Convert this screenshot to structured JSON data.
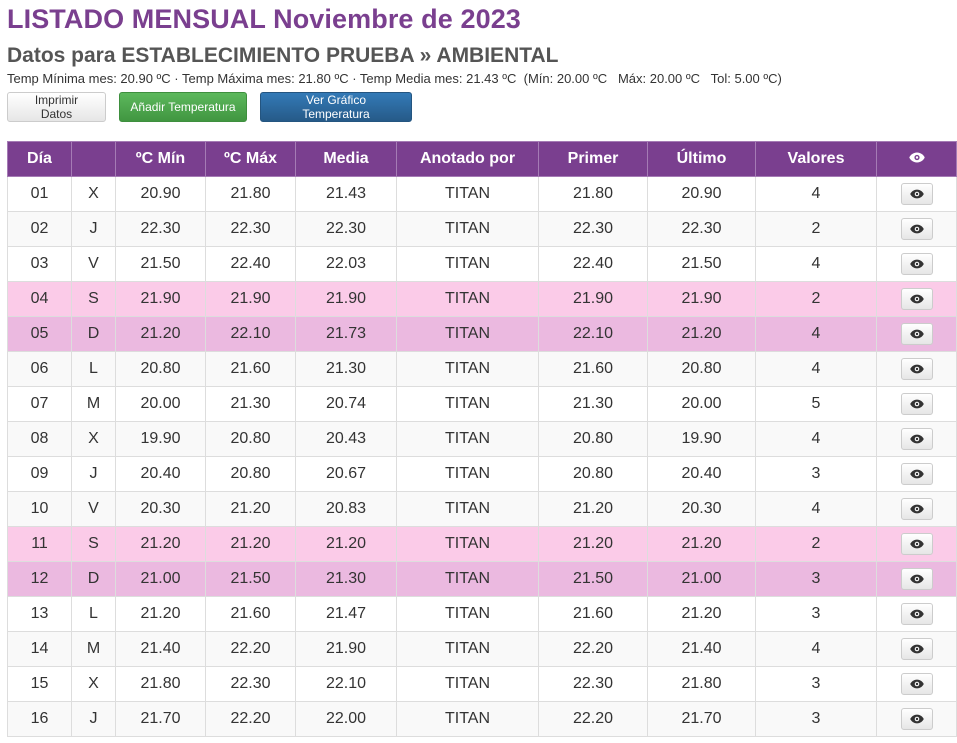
{
  "header": {
    "title": "LISTADO MENSUAL Noviembre de 2023",
    "subtitle": "Datos para ESTABLECIMIENTO PRUEBA » AMBIENTAL",
    "stats": "Temp Mínima mes: 20.90 ºC · Temp Máxima mes: 21.80 ºC · Temp Media mes: 21.43 ºC  (Mín: 20.00 ºC   Máx: 20.00 ºC   Tol: 5.00 ºC)"
  },
  "buttons": {
    "print": "Imprimir Datos",
    "add": "Añadir Temperatura",
    "chart": "Ver Gráfico Temperatura"
  },
  "table": {
    "columns": [
      "Día",
      "",
      "ºC Mín",
      "ºC Máx",
      "Media",
      "Anotado por",
      "Primer",
      "Último",
      "Valores"
    ],
    "action_icon": "eye-icon",
    "rows": [
      {
        "dia": "01",
        "dow": "X",
        "min": "20.90",
        "max": "21.80",
        "media": "21.43",
        "anotado": "TITAN",
        "primer": "21.80",
        "ultimo": "20.90",
        "valores": "4",
        "type": "odd"
      },
      {
        "dia": "02",
        "dow": "J",
        "min": "22.30",
        "max": "22.30",
        "media": "22.30",
        "anotado": "TITAN",
        "primer": "22.30",
        "ultimo": "22.30",
        "valores": "2",
        "type": "even"
      },
      {
        "dia": "03",
        "dow": "V",
        "min": "21.50",
        "max": "22.40",
        "media": "22.03",
        "anotado": "TITAN",
        "primer": "22.40",
        "ultimo": "21.50",
        "valores": "4",
        "type": "odd"
      },
      {
        "dia": "04",
        "dow": "S",
        "min": "21.90",
        "max": "21.90",
        "media": "21.90",
        "anotado": "TITAN",
        "primer": "21.90",
        "ultimo": "21.90",
        "valores": "2",
        "type": "sat"
      },
      {
        "dia": "05",
        "dow": "D",
        "min": "21.20",
        "max": "22.10",
        "media": "21.73",
        "anotado": "TITAN",
        "primer": "22.10",
        "ultimo": "21.20",
        "valores": "4",
        "type": "sun"
      },
      {
        "dia": "06",
        "dow": "L",
        "min": "20.80",
        "max": "21.60",
        "media": "21.30",
        "anotado": "TITAN",
        "primer": "21.60",
        "ultimo": "20.80",
        "valores": "4",
        "type": "even"
      },
      {
        "dia": "07",
        "dow": "M",
        "min": "20.00",
        "max": "21.30",
        "media": "20.74",
        "anotado": "TITAN",
        "primer": "21.30",
        "ultimo": "20.00",
        "valores": "5",
        "type": "odd"
      },
      {
        "dia": "08",
        "dow": "X",
        "min": "19.90",
        "max": "20.80",
        "media": "20.43",
        "anotado": "TITAN",
        "primer": "20.80",
        "ultimo": "19.90",
        "valores": "4",
        "type": "even"
      },
      {
        "dia": "09",
        "dow": "J",
        "min": "20.40",
        "max": "20.80",
        "media": "20.67",
        "anotado": "TITAN",
        "primer": "20.80",
        "ultimo": "20.40",
        "valores": "3",
        "type": "odd"
      },
      {
        "dia": "10",
        "dow": "V",
        "min": "20.30",
        "max": "21.20",
        "media": "20.83",
        "anotado": "TITAN",
        "primer": "21.20",
        "ultimo": "20.30",
        "valores": "4",
        "type": "even"
      },
      {
        "dia": "11",
        "dow": "S",
        "min": "21.20",
        "max": "21.20",
        "media": "21.20",
        "anotado": "TITAN",
        "primer": "21.20",
        "ultimo": "21.20",
        "valores": "2",
        "type": "sat"
      },
      {
        "dia": "12",
        "dow": "D",
        "min": "21.00",
        "max": "21.50",
        "media": "21.30",
        "anotado": "TITAN",
        "primer": "21.50",
        "ultimo": "21.00",
        "valores": "3",
        "type": "sun"
      },
      {
        "dia": "13",
        "dow": "L",
        "min": "21.20",
        "max": "21.60",
        "media": "21.47",
        "anotado": "TITAN",
        "primer": "21.60",
        "ultimo": "21.20",
        "valores": "3",
        "type": "odd"
      },
      {
        "dia": "14",
        "dow": "M",
        "min": "21.40",
        "max": "22.20",
        "media": "21.90",
        "anotado": "TITAN",
        "primer": "22.20",
        "ultimo": "21.40",
        "valores": "4",
        "type": "even"
      },
      {
        "dia": "15",
        "dow": "X",
        "min": "21.80",
        "max": "22.30",
        "media": "22.10",
        "anotado": "TITAN",
        "primer": "22.30",
        "ultimo": "21.80",
        "valores": "3",
        "type": "odd"
      },
      {
        "dia": "16",
        "dow": "J",
        "min": "21.70",
        "max": "22.20",
        "media": "22.00",
        "anotado": "TITAN",
        "primer": "22.20",
        "ultimo": "21.70",
        "valores": "3",
        "type": "even"
      }
    ]
  },
  "colors": {
    "header_bg": "#7a3f8f",
    "saturday_row": "#fbcbe8",
    "sunday_row": "#ebb9e0"
  }
}
